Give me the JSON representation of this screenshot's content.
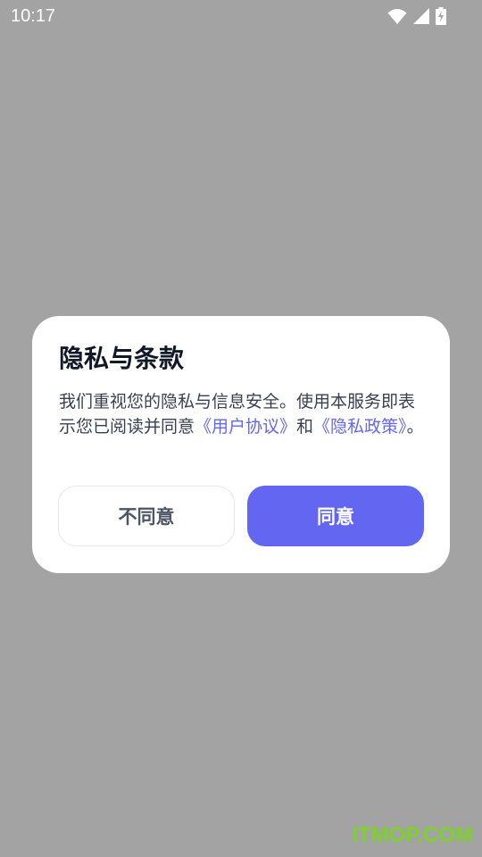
{
  "status_bar": {
    "time": "10:17",
    "icons": [
      "wifi-icon",
      "signal-icon",
      "battery-charging-icon"
    ]
  },
  "dialog": {
    "title": "隐私与条款",
    "message_before": "我们重视您的隐私与信息安全。使用本服务即表示您已阅读并同意",
    "user_agreement_link": "《用户协议》",
    "conjunction": "和",
    "privacy_policy_link": "《隐私政策》",
    "message_end": "。",
    "disagree_label": "不同意",
    "agree_label": "同意"
  },
  "watermark": "ITMOP.COM",
  "colors": {
    "overlay": "#a3a3a3",
    "accent": "#6366f1",
    "title": "#111827",
    "body_text": "#374151",
    "watermark": "#7cd22a"
  }
}
